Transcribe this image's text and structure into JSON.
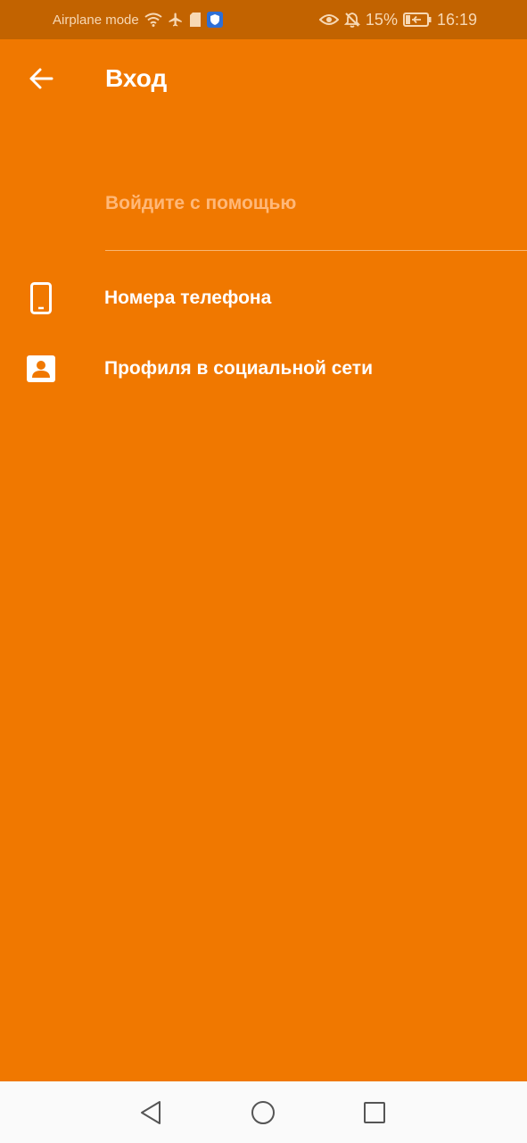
{
  "status_bar": {
    "left_text": "Airplane mode",
    "battery_percent": "15%",
    "time": "16:19",
    "icons": [
      "wifi-icon",
      "airplane-icon",
      "sim-card-icon",
      "shield-icon",
      "eye-icon",
      "bell-off-icon",
      "battery-charging-icon"
    ]
  },
  "app_bar": {
    "title": "Вход",
    "back_icon": "arrow-left-icon"
  },
  "main": {
    "subtitle": "Войдите с помощью",
    "options": [
      {
        "label": "Номера телефона",
        "icon": "phone-icon"
      },
      {
        "label": "Профиля в социальной сети",
        "icon": "contact-card-icon"
      }
    ]
  },
  "nav_bar": {
    "buttons": [
      "back-triangle-icon",
      "home-circle-icon",
      "recents-square-icon"
    ]
  },
  "colors": {
    "background": "#F07800",
    "status_bar": "#C26300",
    "subtitle": "#FFB878",
    "nav_bar": "#FAFAFA"
  }
}
